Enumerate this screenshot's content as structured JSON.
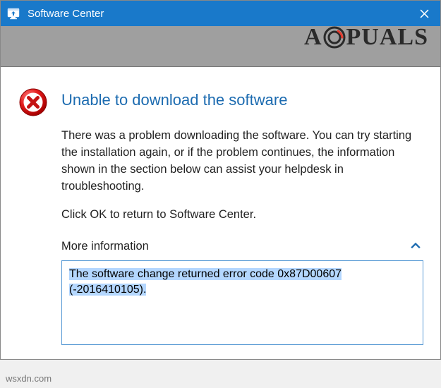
{
  "titlebar": {
    "title": "Software Center"
  },
  "error": {
    "heading": "Unable to download the software",
    "body": "There was a problem downloading the software.  You can try starting the installation again, or if the problem continues, the information shown in the section below can assist your helpdesk in troubleshooting.",
    "ok_line": "Click OK to return to Software Center.",
    "more_info_label": "More information",
    "detail": "The software change returned error code 0x87D00607 (-2016410105)."
  },
  "watermark": {
    "prefix": "A",
    "suffix": "PUALS"
  },
  "source": "wsxdn.com"
}
